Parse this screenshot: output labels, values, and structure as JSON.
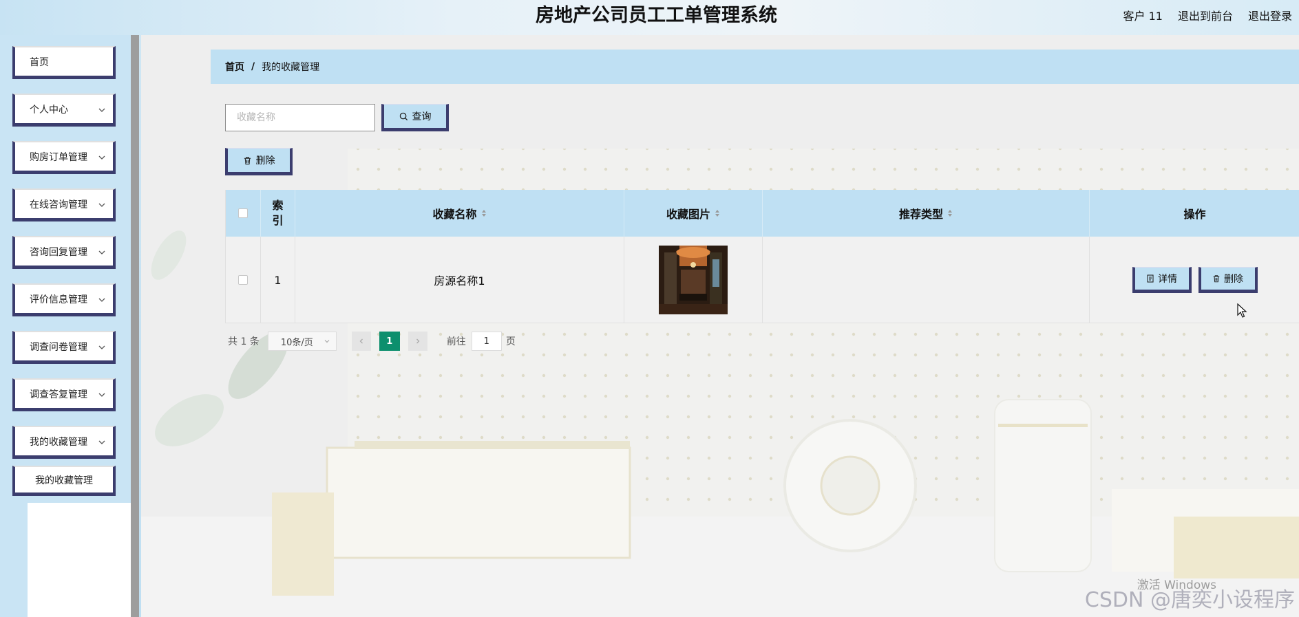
{
  "header": {
    "title": "房地产公司员工工单管理系统",
    "user": "客户 11",
    "back_to_front": "退出到前台",
    "logout": "退出登录"
  },
  "sidebar": {
    "items": [
      {
        "label": "首页",
        "has_children": false
      },
      {
        "label": "个人中心",
        "has_children": true
      },
      {
        "label": "购房订单管理",
        "has_children": true
      },
      {
        "label": "在线咨询管理",
        "has_children": true
      },
      {
        "label": "咨询回复管理",
        "has_children": true
      },
      {
        "label": "评价信息管理",
        "has_children": true
      },
      {
        "label": "调查问卷管理",
        "has_children": true
      },
      {
        "label": "调查答复管理",
        "has_children": true
      },
      {
        "label": "我的收藏管理",
        "has_children": true
      }
    ],
    "sub_item": "我的收藏管理"
  },
  "breadcrumb": {
    "home": "首页",
    "separator": "/",
    "current": "我的收藏管理"
  },
  "search": {
    "placeholder": "收藏名称",
    "value": "",
    "query_label": "查询"
  },
  "toolbar": {
    "delete_label": "删除"
  },
  "table": {
    "columns": {
      "index": "索引",
      "name": "收藏名称",
      "image": "收藏图片",
      "type": "推荐类型",
      "actions": "操作"
    },
    "rows": [
      {
        "index": "1",
        "name": "房源名称1",
        "type": "",
        "image_alt": "interior-photo"
      }
    ],
    "row_actions": {
      "detail_label": "详情",
      "delete_label": "删除"
    }
  },
  "pagination": {
    "total": "共 1 条",
    "page_size": "10条/页",
    "current_page": "1",
    "goto_prefix": "前往",
    "goto_value": "1",
    "goto_suffix": "页"
  },
  "overlay": {
    "windows_activation": "激活 Windows",
    "watermark": "CSDN @唐奕小设程序"
  },
  "colors": {
    "accent": "#bfe0f3",
    "border_dark": "#3b3d6e",
    "page_active": "#0d8f6d"
  }
}
